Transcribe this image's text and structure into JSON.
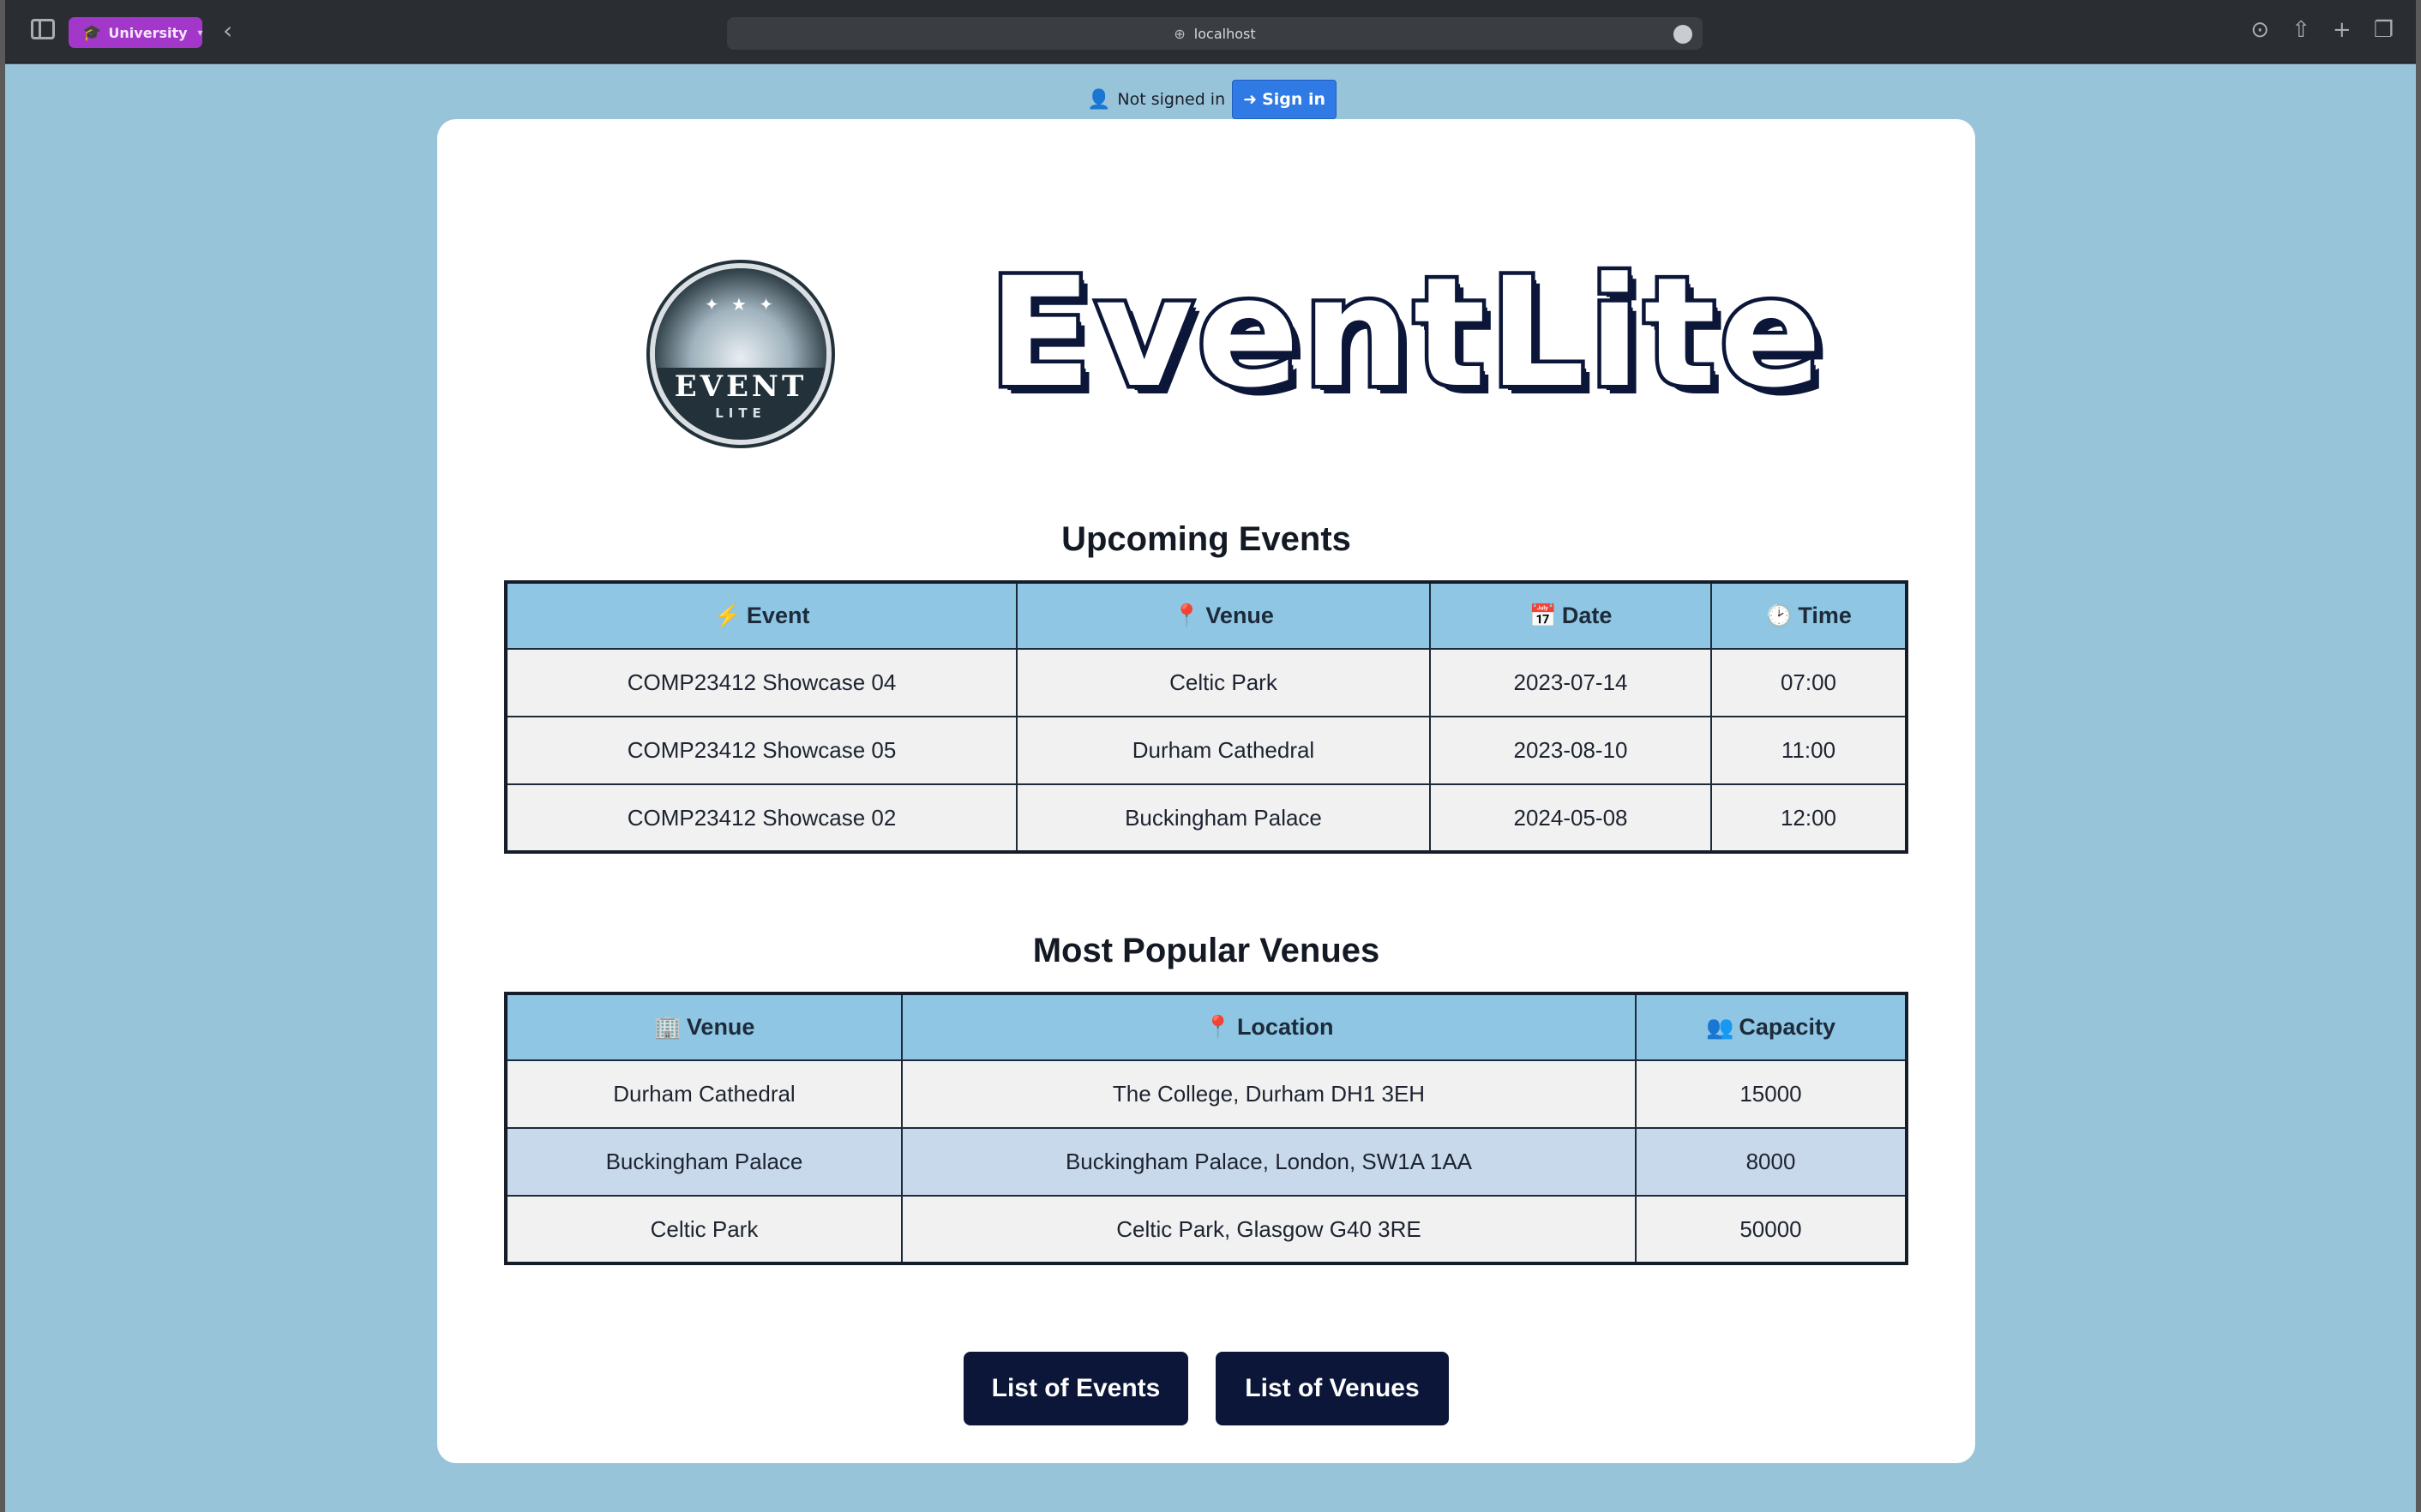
{
  "browser": {
    "profile_label": "University",
    "url": "localhost"
  },
  "auth": {
    "status_text": "Not signed in",
    "sign_in_label": "Sign in"
  },
  "branding": {
    "logo_text": "EVENT",
    "logo_subtext": "LITE",
    "wordmark": "EventLite"
  },
  "events": {
    "title": "Upcoming Events",
    "headers": [
      "Event",
      "Venue",
      "Date",
      "Time"
    ],
    "rows": [
      [
        "COMP23412 Showcase 04",
        "Celtic Park",
        "2023-07-14",
        "07:00"
      ],
      [
        "COMP23412 Showcase 05",
        "Durham Cathedral",
        "2023-08-10",
        "11:00"
      ],
      [
        "COMP23412 Showcase 02",
        "Buckingham Palace",
        "2024-05-08",
        "12:00"
      ]
    ]
  },
  "venues": {
    "title": "Most Popular Venues",
    "headers": [
      "Venue",
      "Location",
      "Capacity"
    ],
    "rows": [
      [
        "Durham Cathedral",
        "The College, Durham DH1 3EH",
        "15000"
      ],
      [
        "Buckingham Palace",
        "Buckingham Palace, London, SW1A 1AA",
        "8000"
      ],
      [
        "Celtic Park",
        "Celtic Park, Glasgow G40 3RE",
        "50000"
      ]
    ],
    "highlighted_row": 1
  },
  "buttons": {
    "list_events": "List of Events",
    "list_venues": "List of Venues"
  },
  "colors": {
    "page_bg": "#98c4da",
    "header_bg": "#8ec6e3",
    "highlight_row": "#c9d9ec",
    "button_bg": "#0b1638",
    "sign_in_bg": "#2f7ae5"
  }
}
